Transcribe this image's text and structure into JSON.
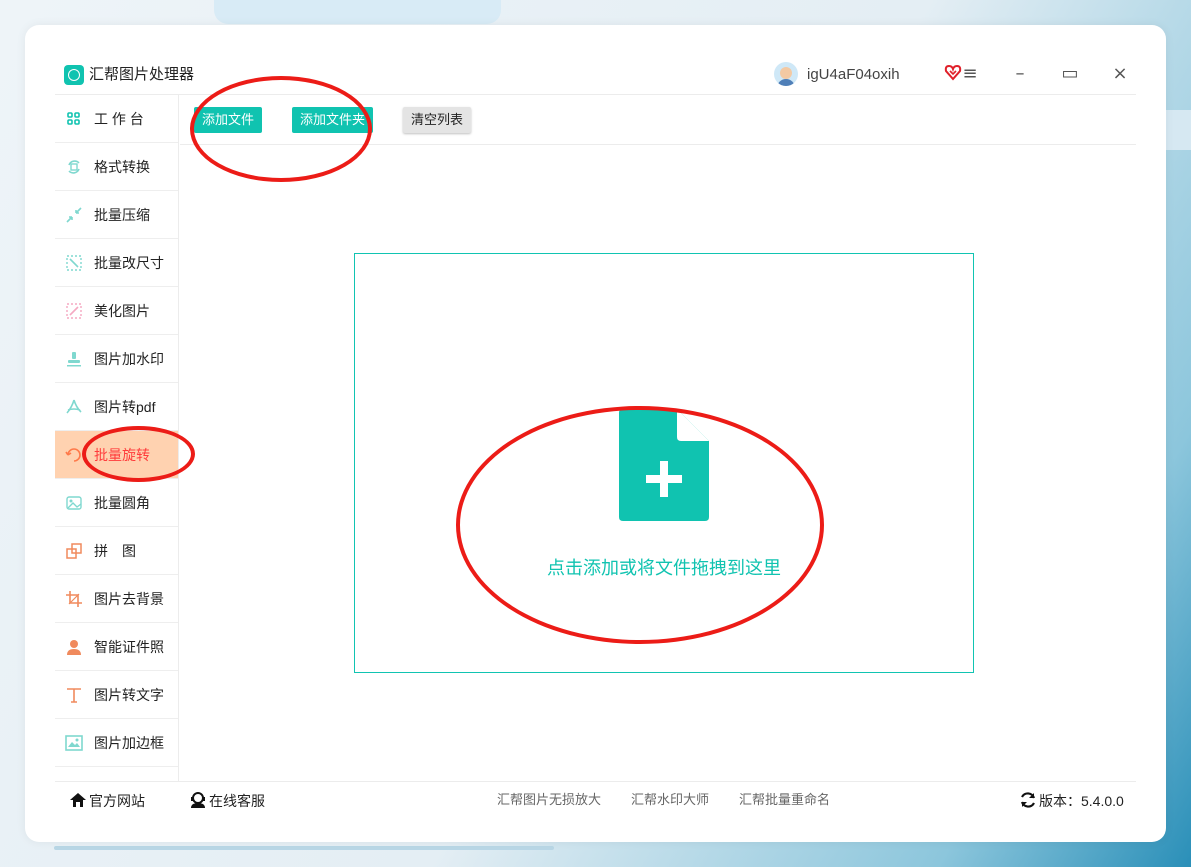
{
  "app": {
    "title": "汇帮图片处理器"
  },
  "user": {
    "name": "igU4aF04oxih"
  },
  "window_controls": {
    "menu": "≡",
    "minimize": "–",
    "maximize": "▭",
    "close": "×"
  },
  "toolbar": {
    "add_file": "添加文件",
    "add_folder": "添加文件夹",
    "clear_list": "清空列表"
  },
  "sidebar": {
    "items": [
      {
        "label": "工 作 台",
        "icon": "grid-icon"
      },
      {
        "label": "格式转换",
        "icon": "format-convert-icon"
      },
      {
        "label": "批量压缩",
        "icon": "compress-icon"
      },
      {
        "label": "批量改尺寸",
        "icon": "resize-icon"
      },
      {
        "label": "美化图片",
        "icon": "beautify-icon"
      },
      {
        "label": "图片加水印",
        "icon": "watermark-icon"
      },
      {
        "label": "图片转pdf",
        "icon": "pdf-icon"
      },
      {
        "label": "批量旋转",
        "icon": "rotate-icon",
        "active": true
      },
      {
        "label": "批量圆角",
        "icon": "rounded-corner-icon"
      },
      {
        "label": "拼　图",
        "icon": "collage-icon"
      },
      {
        "label": "图片去背景",
        "icon": "crop-icon"
      },
      {
        "label": "智能证件照",
        "icon": "id-photo-icon"
      },
      {
        "label": "图片转文字",
        "icon": "text-icon"
      },
      {
        "label": "图片加边框",
        "icon": "frame-icon"
      }
    ]
  },
  "dropzone": {
    "text": "点击添加或将文件拖拽到这里"
  },
  "footer": {
    "website": "官方网站",
    "support": "在线客服",
    "links": [
      "汇帮图片无损放大",
      "汇帮水印大师",
      "汇帮批量重命名"
    ],
    "version_label": "版本：",
    "version": "5.4.0.0"
  },
  "colors": {
    "accent": "#10c3b0",
    "active_bg": "#ffd2b0",
    "active_text": "#ff3b3b",
    "annotation": "#ec1c17"
  }
}
